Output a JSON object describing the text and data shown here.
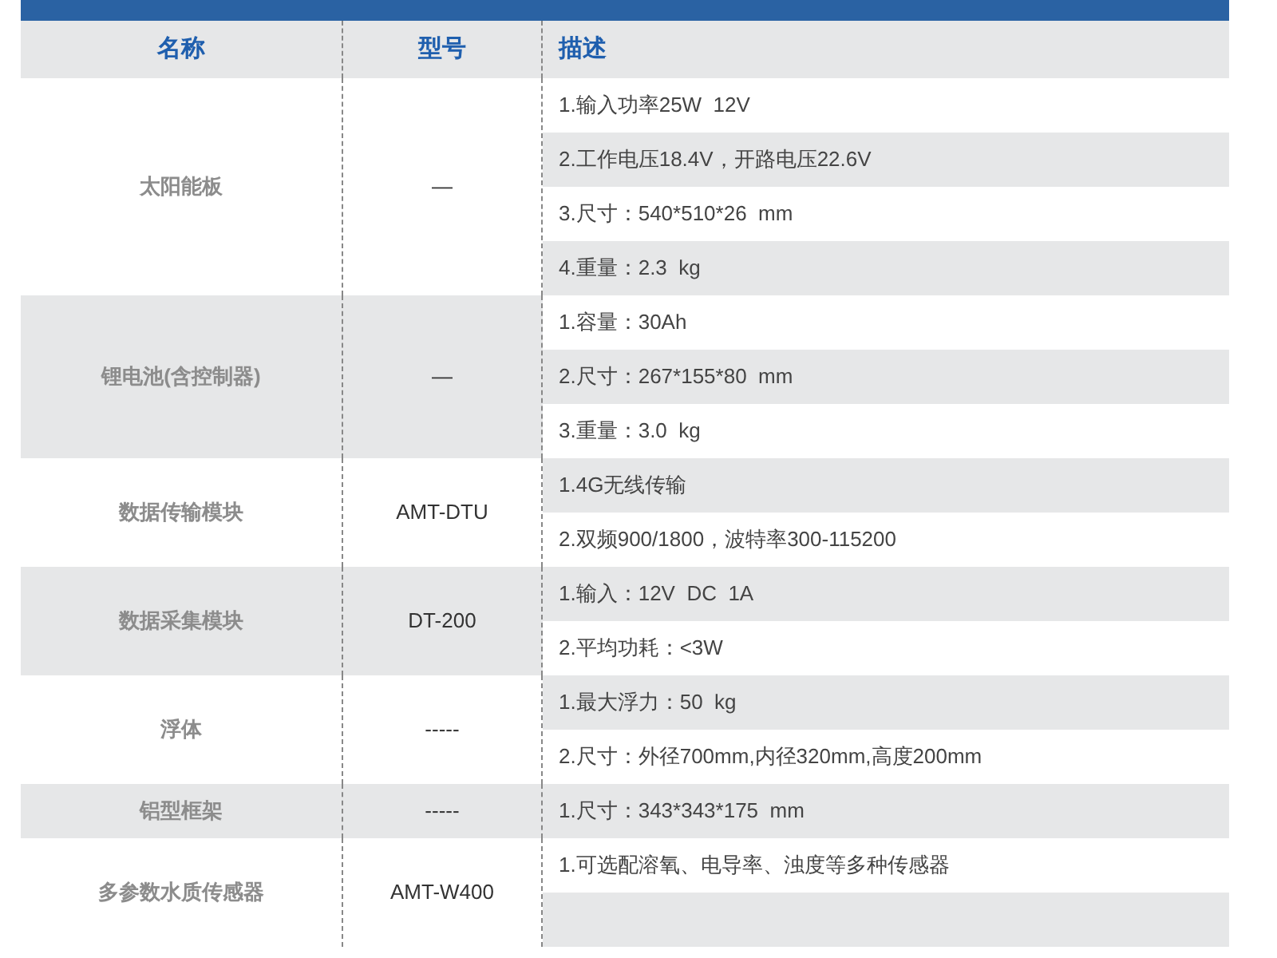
{
  "table": {
    "columns": [
      "名称",
      "型号",
      "描述"
    ],
    "rows": [
      {
        "name": "太阳能板",
        "model": "—",
        "description": [
          "1.输入功率25W  12V",
          "2.工作电压18.4V，开路电压22.6V",
          "3.尺寸：540*510*26  mm",
          "4.重量：2.3  kg"
        ]
      },
      {
        "name": "锂电池(含控制器)",
        "model": "—",
        "description": [
          "1.容量：30Ah",
          "2.尺寸：267*155*80  mm",
          "3.重量：3.0  kg"
        ]
      },
      {
        "name": "数据传输模块",
        "model": "AMT-DTU",
        "description": [
          "1.4G无线传输",
          "2.双频900/1800，波特率300-115200"
        ]
      },
      {
        "name": "数据采集模块",
        "model": "DT-200",
        "description": [
          "1.输入：12V  DC  1A",
          "2.平均功耗：<3W"
        ]
      },
      {
        "name": "浮体",
        "model": "-----",
        "description": [
          "1.最大浮力：50  kg",
          "2.尺寸：外径700mm,内径320mm,高度200mm"
        ]
      },
      {
        "name": "铝型框架",
        "model": "-----",
        "description": [
          "1.尺寸：343*343*175  mm"
        ]
      },
      {
        "name": "多参数水质传感器",
        "model": "AMT-W400",
        "description": [
          "1.可选配溶氧、电导率、浊度等多种传感器"
        ]
      }
    ]
  }
}
